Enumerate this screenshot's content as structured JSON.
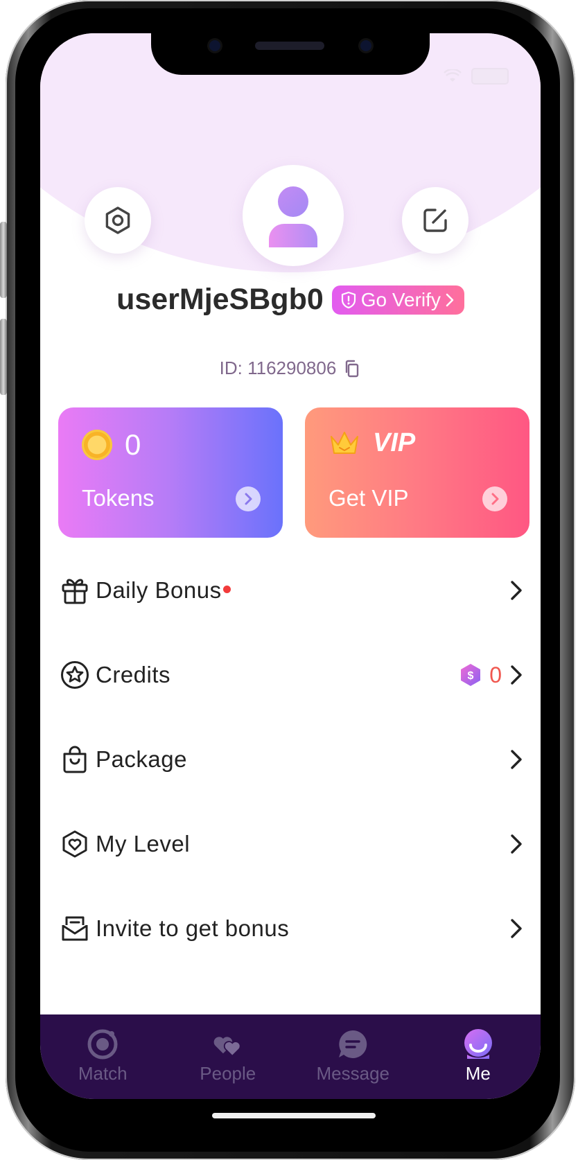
{
  "profile": {
    "username": "userMjeSBgb0",
    "verify_label": "Go Verify",
    "id_text": "ID: 116290806"
  },
  "cards": {
    "tokens": {
      "value": "0",
      "label": "Tokens"
    },
    "vip": {
      "badge": "VIP",
      "label": "Get VIP"
    }
  },
  "menu": {
    "items": [
      {
        "label": "Daily Bonus",
        "icon": "gift-icon",
        "has_dot": true
      },
      {
        "label": "Credits",
        "icon": "star-icon",
        "value": "0"
      },
      {
        "label": "Package",
        "icon": "bag-icon"
      },
      {
        "label": "My Level",
        "icon": "shield-heart-icon"
      },
      {
        "label": "Invite to get bonus",
        "icon": "mail-icon"
      }
    ]
  },
  "tabs": [
    {
      "label": "Match",
      "icon": "match-icon"
    },
    {
      "label": "People",
      "icon": "people-icon"
    },
    {
      "label": "Message",
      "icon": "message-icon"
    },
    {
      "label": "Me",
      "icon": "me-icon",
      "active": true
    }
  ],
  "colors": {
    "accent_purple": "#2b0e4a",
    "tokens_gradient": [
      "#ea7bf5",
      "#6a72fb"
    ],
    "vip_gradient": [
      "#ff9a7c",
      "#ff5783"
    ],
    "hero_bg": "#f6e8fb",
    "credits_value": "#f0574f"
  }
}
